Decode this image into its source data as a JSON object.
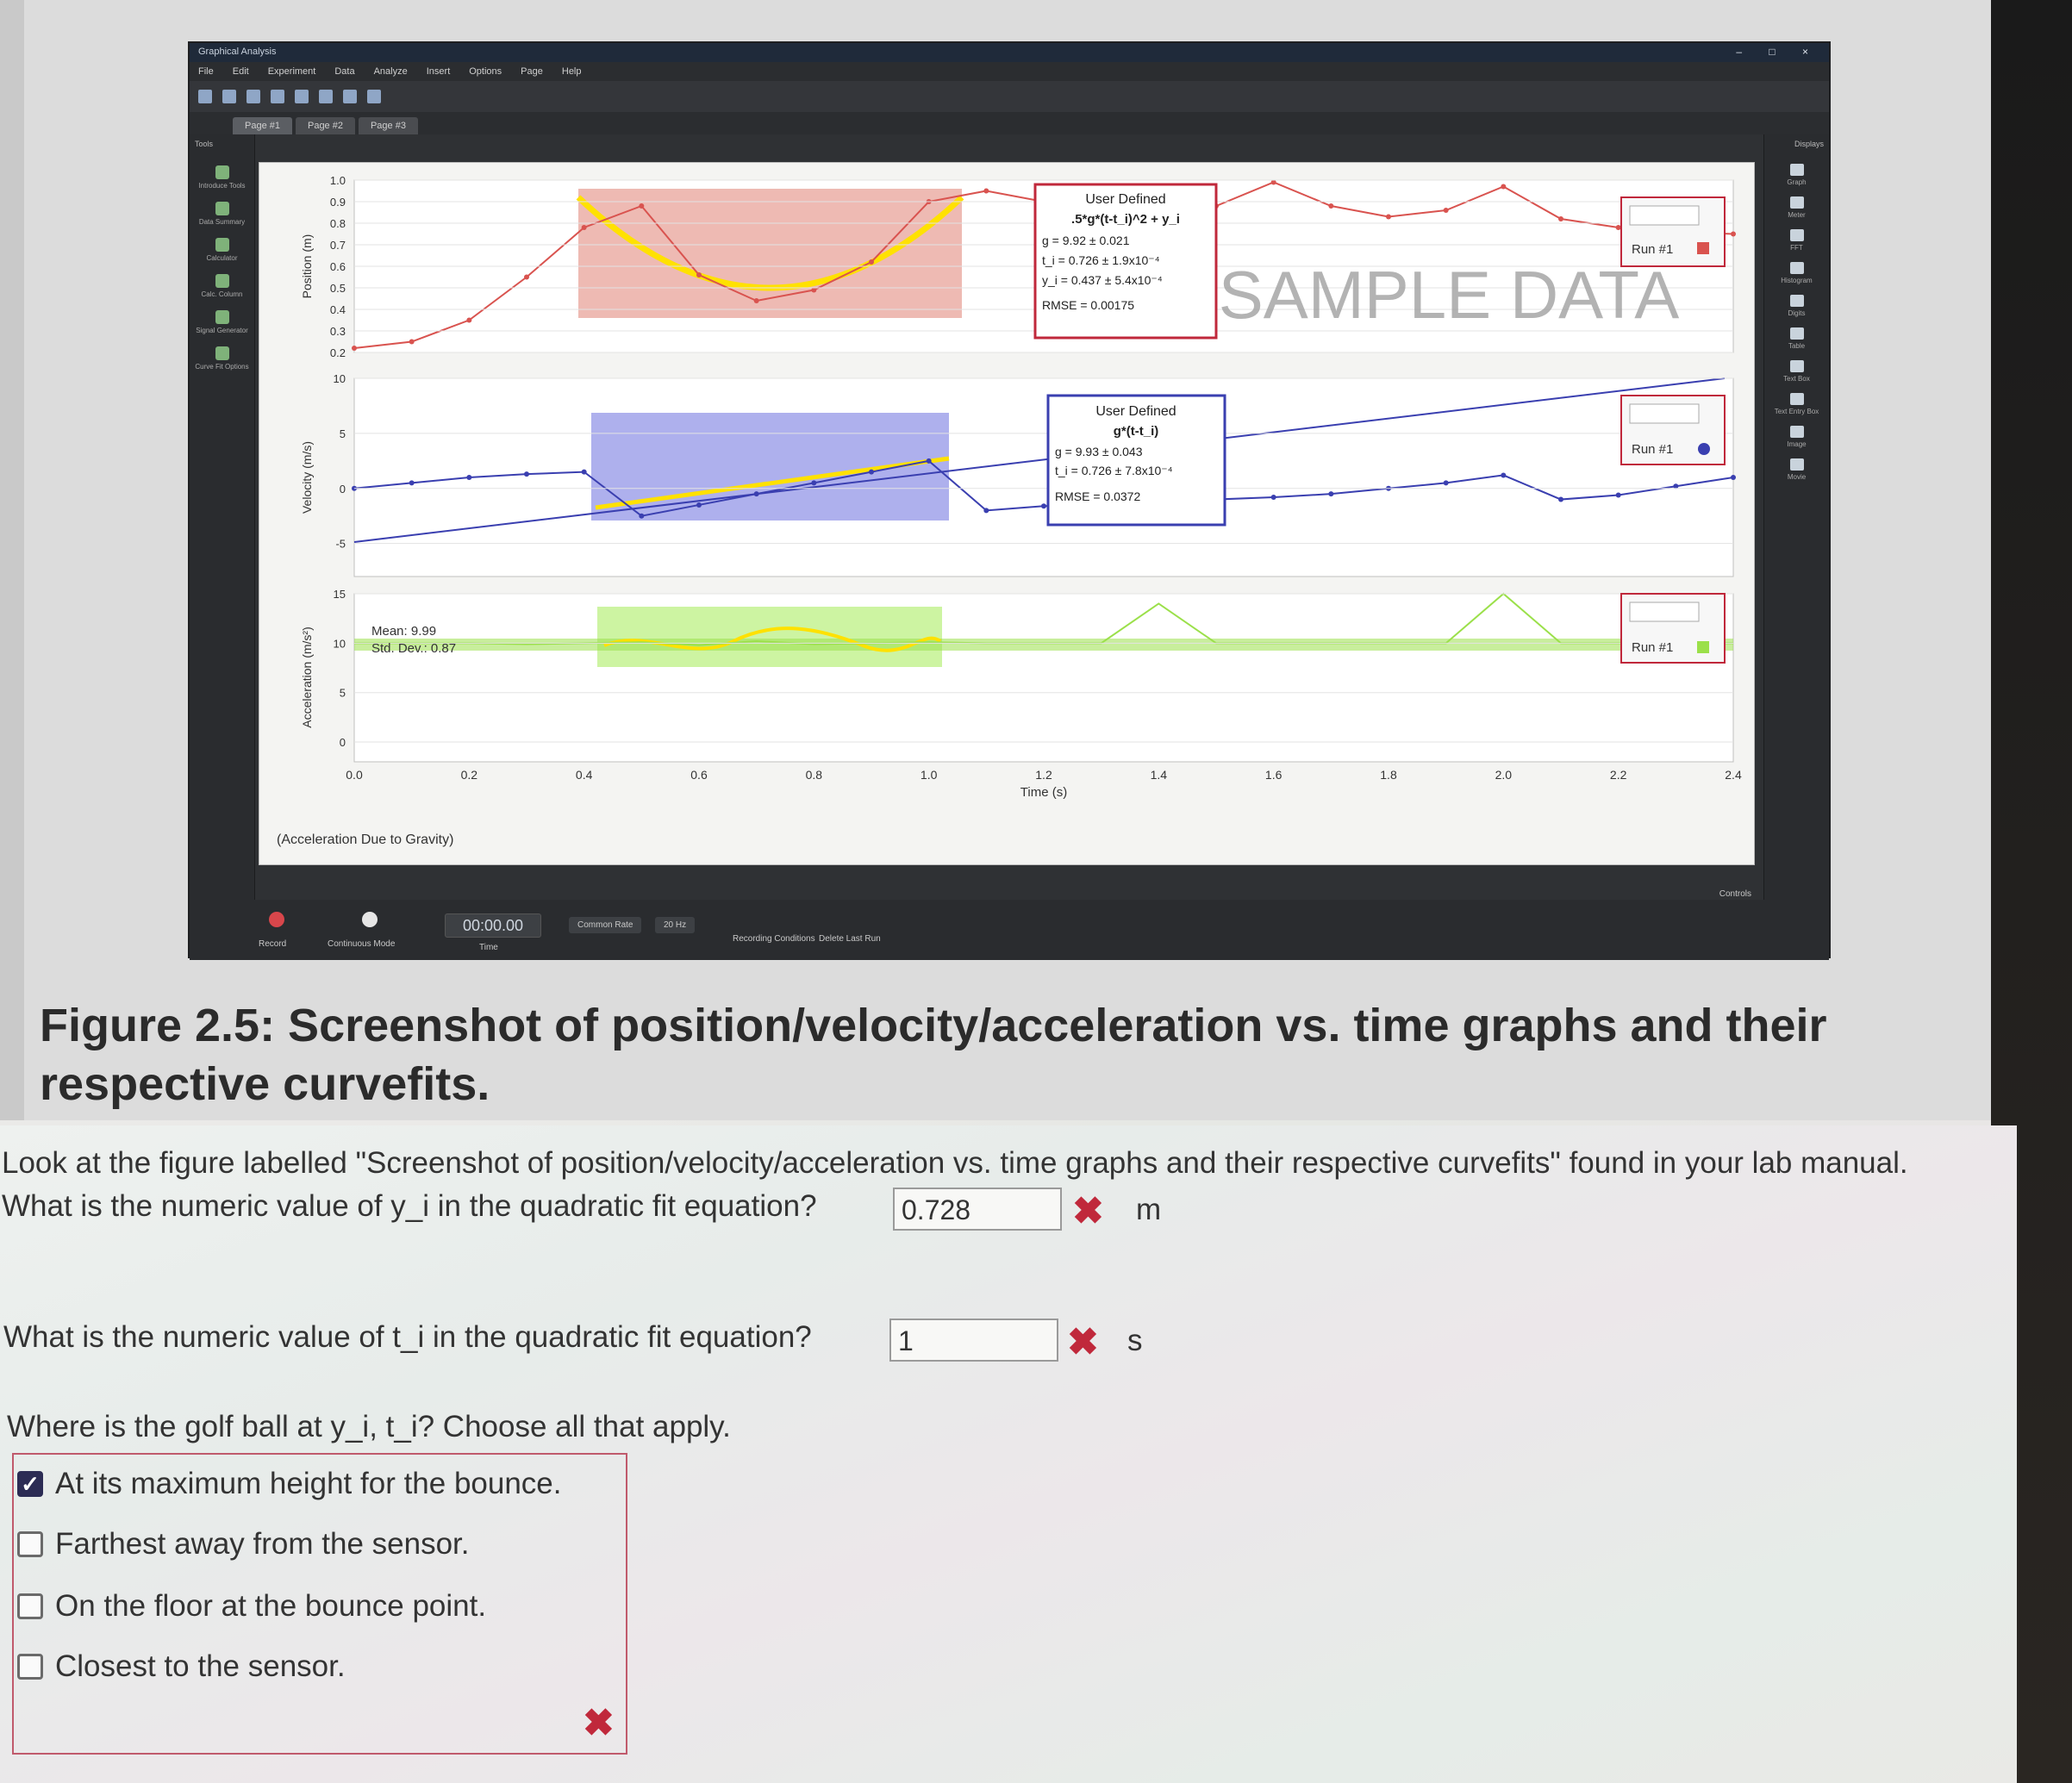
{
  "app": {
    "title": "Graphical Analysis",
    "window_controls": "– □ ×",
    "menu": [
      "File",
      "Edit",
      "Experiment",
      "Data",
      "Analyze",
      "Insert",
      "Options",
      "Page",
      "Help"
    ],
    "tabs": [
      "Page #1",
      "Page #2",
      "Page #3"
    ],
    "tools_label": "Tools",
    "tools": [
      "Introduce Tools",
      "Data Summary",
      "Calculator",
      "Calc. Column",
      "Signal Generator",
      "Curve Fit Options"
    ],
    "display_label": "Displays",
    "displays": [
      "Graph",
      "Meter",
      "FFT",
      "Histogram",
      "Digits",
      "Table",
      "Text Box",
      "Text Entry Box",
      "Image",
      "Movie"
    ],
    "sample_watermark": "SAMPLE DATA",
    "graph_caption": "(Acceleration Due to Gravity)",
    "controls": {
      "record_label": "Record",
      "mode_label": "Continuous Mode",
      "timer": "00:00.00",
      "timer_label": "Time",
      "rate_label": "Common Rate",
      "rate_value": "20 Hz",
      "recording_conditions": "Recording Conditions",
      "delete_last_run": "Delete Last Run",
      "controls_label": "Controls"
    }
  },
  "chart_data": [
    {
      "type": "line",
      "ylabel": "Position (m)",
      "ylim": [
        0.2,
        1.0
      ],
      "yticks": [
        "1.0",
        "0.9",
        "0.8",
        "0.7",
        "0.6",
        "0.5",
        "0.4",
        "0.3",
        "0.2"
      ],
      "x": [
        0.0,
        0.1,
        0.2,
        0.3,
        0.4,
        0.5,
        0.6,
        0.7,
        0.8,
        0.9,
        1.0,
        1.1,
        1.2,
        1.3,
        1.4,
        1.5,
        1.6,
        1.7,
        1.8,
        1.9,
        2.0,
        2.1,
        2.2,
        2.3,
        2.4
      ],
      "series": [
        {
          "name": "Run #1",
          "values": [
            0.22,
            0.25,
            0.35,
            0.55,
            0.78,
            0.88,
            0.56,
            0.44,
            0.49,
            0.62,
            0.9,
            0.95,
            0.9,
            0.84,
            0.85,
            0.88,
            0.99,
            0.88,
            0.83,
            0.86,
            0.97,
            0.82,
            0.78,
            0.76,
            0.75
          ]
        }
      ],
      "fit_box": {
        "title": "User Defined",
        "equation": ".5*g*(t-t_i)^2 + y_i",
        "lines": [
          "g = 9.92 ± 0.021",
          "t_i = 0.726 ± 1.9x10⁻⁴",
          "y_i = 0.437 ± 5.4x10⁻⁴",
          "RMSE = 0.00175"
        ]
      },
      "legend": "Run #1"
    },
    {
      "type": "line",
      "ylabel": "Velocity (m/s)",
      "ylim": [
        -8,
        10
      ],
      "yticks": [
        "10",
        "5",
        "0",
        "-5"
      ],
      "x": [
        0.0,
        0.1,
        0.2,
        0.3,
        0.4,
        0.5,
        0.6,
        0.7,
        0.8,
        0.9,
        1.0,
        1.1,
        1.2,
        1.3,
        1.4,
        1.5,
        1.6,
        1.7,
        1.8,
        1.9,
        2.0,
        2.1,
        2.2,
        2.3,
        2.4
      ],
      "series": [
        {
          "name": "Run #1",
          "values": [
            0.0,
            0.5,
            1.0,
            1.3,
            1.5,
            -2.5,
            -1.5,
            -0.5,
            0.5,
            1.5,
            2.5,
            -2.0,
            -1.6,
            -1.5,
            1.5,
            -1.0,
            -0.8,
            -0.5,
            0.0,
            0.5,
            1.2,
            -1.0,
            -0.6,
            0.2,
            1.0
          ]
        }
      ],
      "fit_box": {
        "title": "User Defined",
        "equation": "g*(t-t_i)",
        "lines": [
          "g = 9.93 ± 0.043",
          "t_i = 0.726 ± 7.8x10⁻⁴",
          "RMSE = 0.0372"
        ]
      },
      "legend": "Run #1"
    },
    {
      "type": "line",
      "ylabel": "Acceleration (m/s²)",
      "ylim": [
        -2,
        15
      ],
      "yticks": [
        "15",
        "10",
        "5",
        "0"
      ],
      "x": [
        0.0,
        0.1,
        0.2,
        0.3,
        0.4,
        0.5,
        0.6,
        0.7,
        0.8,
        0.9,
        1.0,
        1.1,
        1.2,
        1.3,
        1.4,
        1.5,
        1.6,
        1.7,
        1.8,
        1.9,
        2.0,
        2.1,
        2.2,
        2.3,
        2.4
      ],
      "series": [
        {
          "name": "Run #1",
          "values": [
            10,
            10,
            10,
            9.9,
            10,
            10.1,
            9.8,
            10.2,
            9.9,
            10.0,
            10.1,
            10,
            10,
            10,
            14,
            10,
            10,
            10,
            10,
            10,
            15,
            10,
            10,
            10,
            10
          ]
        }
      ],
      "stats_box": {
        "lines": [
          "Mean: 9.99",
          "Std. Dev.: 0.87"
        ]
      },
      "legend": "Run #1"
    }
  ],
  "x_axis": {
    "label": "Time (s)",
    "ticks": [
      "0.0",
      "0.2",
      "0.4",
      "0.6",
      "0.8",
      "1.0",
      "1.2",
      "1.4",
      "1.6",
      "1.8",
      "2.0",
      "2.2",
      "2.4"
    ]
  },
  "figure_caption": "Figure 2.5: Screenshot of position/velocity/acceleration vs. time graphs and their respective curvefits.",
  "questions": {
    "intro": "Look at the figure labelled \"Screenshot of position/velocity/acceleration vs. time graphs and their respective curvefits\" found in your lab manual.",
    "q1": {
      "text": "What is the numeric value of y_i in the quadratic fit equation?",
      "answer": "0.728",
      "unit": "m",
      "status_mark": "✖"
    },
    "q2": {
      "text": "What is the numeric value of t_i in the quadratic fit equation?",
      "answer": "1",
      "unit": "s",
      "status_mark": "✖"
    },
    "q3": {
      "text": "Where is the golf ball at y_i, t_i? Choose all that apply.",
      "options": [
        {
          "label": "At its maximum height for the bounce.",
          "checked": true
        },
        {
          "label": "Farthest away from the sensor.",
          "checked": false
        },
        {
          "label": "On the floor at the bounce point.",
          "checked": false
        },
        {
          "label": "Closest to the sensor.",
          "checked": false
        }
      ],
      "status_mark": "✖"
    }
  },
  "colors": {
    "position_series": "#d9534f",
    "position_fit_region": "#e8a39a",
    "fit_curve": "#ffe100",
    "velocity_series": "#3a3fb0",
    "velocity_fit_region": "#8c8fe6",
    "accel_series": "#9be04a",
    "accel_fit_region": "#b8f07a",
    "error_mark": "#c0283b"
  }
}
